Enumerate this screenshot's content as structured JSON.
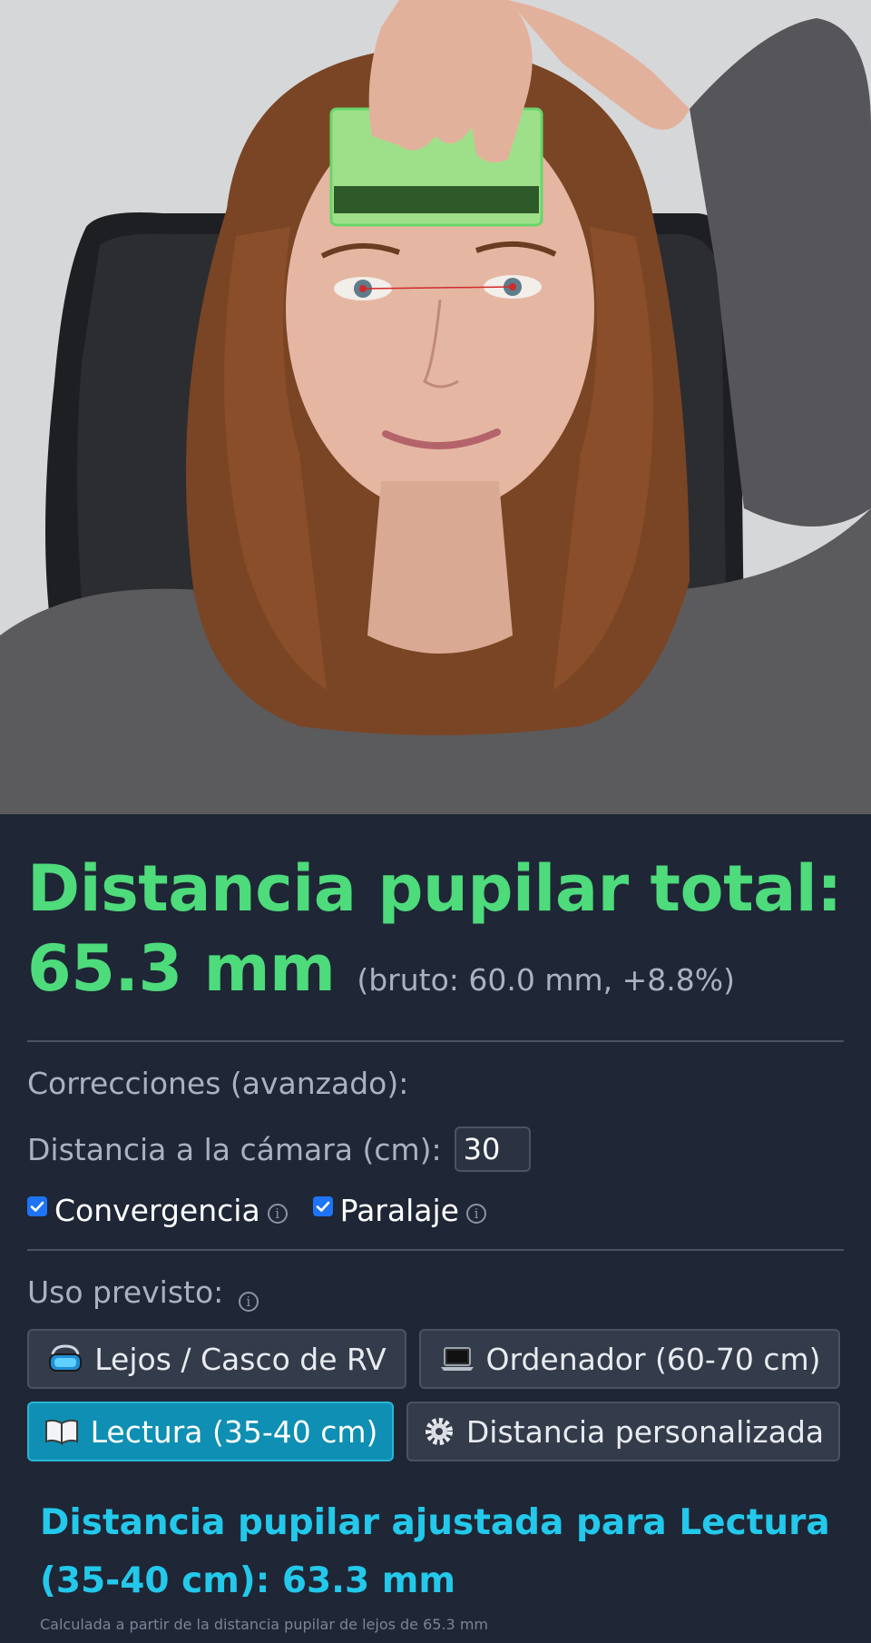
{
  "photo": {
    "alt": "selfie-with-card-on-forehead"
  },
  "result": {
    "title": "Distancia pupilar total:",
    "value": "65.3 mm",
    "raw": "(bruto: 60.0 mm, +8.8%)"
  },
  "corrections": {
    "heading": "Correcciones (avanzado):",
    "distance_label": "Distancia a la cámara (cm):",
    "distance_value": "30",
    "convergence_label": "Convergencia",
    "convergence_checked": true,
    "parallax_label": "Paralaje",
    "parallax_checked": true,
    "info_glyph": "i"
  },
  "usage": {
    "heading": "Uso previsto:",
    "options": [
      {
        "label": "Lejos / Casco de RV",
        "icon": "vr-headset-icon",
        "active": false
      },
      {
        "label": "Ordenador (60-70 cm)",
        "icon": "laptop-icon",
        "active": false
      },
      {
        "label": "Lectura (35-40 cm)",
        "icon": "open-book-icon",
        "active": true
      },
      {
        "label": "Distancia personalizada",
        "icon": "gear-icon",
        "active": false
      }
    ]
  },
  "adjusted": {
    "text": "Distancia pupilar ajustada para Lectura (35-40 cm): 63.3 mm",
    "note": "Calculada a partir de la distancia pupilar de lejos de 65.3 mm"
  },
  "colors": {
    "background": "#1f2636",
    "accent_green": "#4ddb7b",
    "accent_cyan": "#23c8ea",
    "active_button": "#0e8fb3"
  }
}
